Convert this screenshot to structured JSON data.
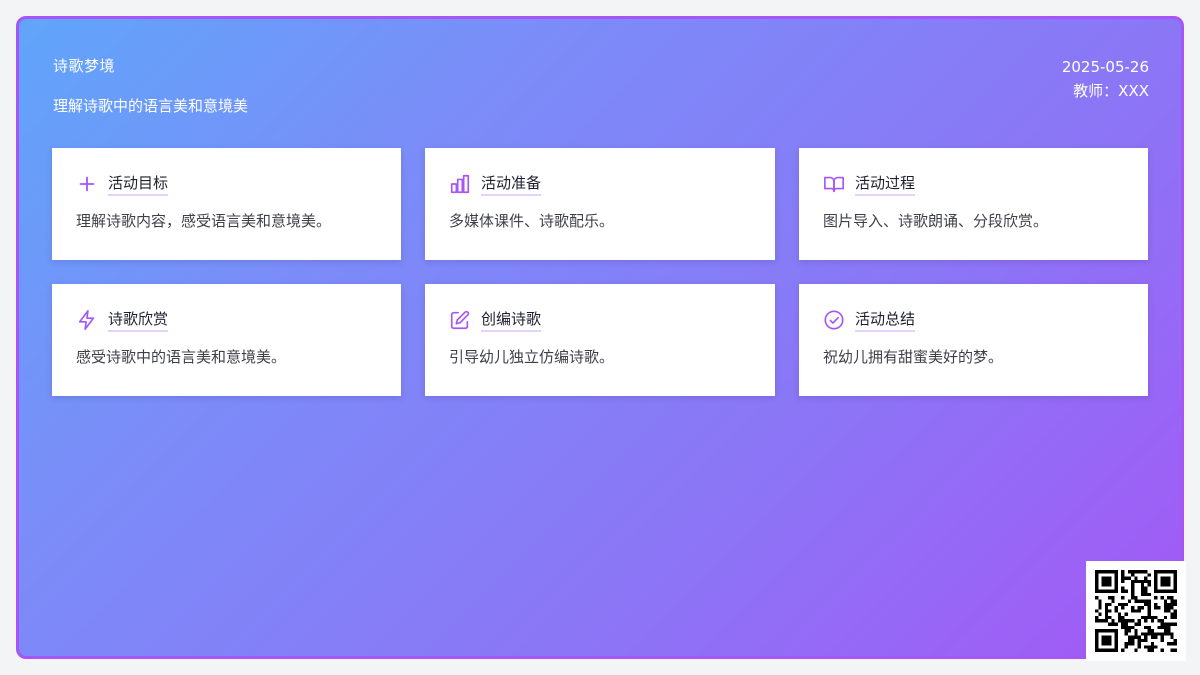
{
  "header": {
    "title": "诗歌梦境",
    "subtitle": "理解诗歌中的语言美和意境美",
    "date": "2025-05-26",
    "teacher": "教师：XXX"
  },
  "accent_color": "#a855f7",
  "cards": [
    {
      "icon": "plus-icon",
      "title": "活动目标",
      "desc": "理解诗歌内容，感受语言美和意境美。"
    },
    {
      "icon": "bar-chart-icon",
      "title": "活动准备",
      "desc": "多媒体课件、诗歌配乐。"
    },
    {
      "icon": "book-open-icon",
      "title": "活动过程",
      "desc": "图片导入、诗歌朗诵、分段欣赏。"
    },
    {
      "icon": "lightning-icon",
      "title": "诗歌欣赏",
      "desc": "感受诗歌中的语言美和意境美。"
    },
    {
      "icon": "edit-icon",
      "title": "创编诗歌",
      "desc": "引导幼儿独立仿编诗歌。"
    },
    {
      "icon": "check-circle-icon",
      "title": "活动总结",
      "desc": "祝幼儿拥有甜蜜美好的梦。"
    }
  ]
}
